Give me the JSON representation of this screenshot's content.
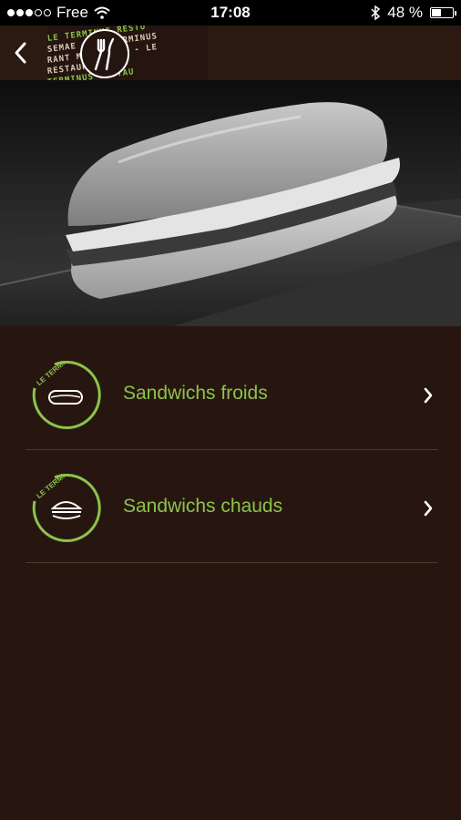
{
  "status_bar": {
    "carrier": "Free",
    "time": "17:08",
    "battery": "48 %",
    "battery_level": 0.48,
    "signal_bars": 3,
    "signal_total": 5
  },
  "nav": {
    "back_icon": "chevron-left-icon",
    "logo": {
      "lines": [
        "LE TERMINUS RESTO",
        "SEMAE - LE TERMINUS",
        "RANT MARSEILLE - LE",
        "RESTAURANT MAR",
        "TERMINUS RESTAU"
      ],
      "badge_icon": "fork-knife-icon"
    }
  },
  "hero": {
    "description_icon": "sandwich-photo"
  },
  "menu": {
    "items": [
      {
        "label": "Sandwichs froids",
        "icon": "baguette-icon",
        "badge_text": "LE TERMINUS"
      },
      {
        "label": "Sandwichs chauds",
        "icon": "burger-icon",
        "badge_text": "LE TERMINUS"
      }
    ]
  },
  "colors": {
    "accent": "#8bc34a",
    "background": "#271610",
    "navbar": "#2a1a12"
  }
}
